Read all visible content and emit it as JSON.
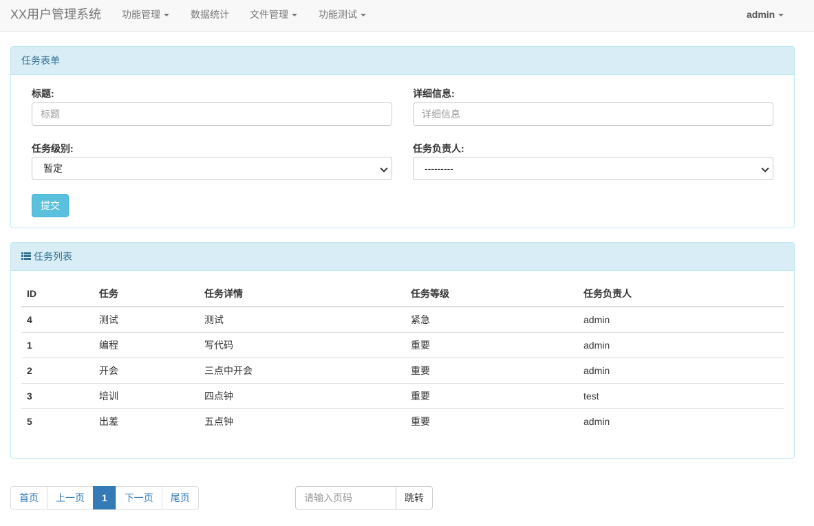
{
  "navbar": {
    "brand": "XX用户管理系统",
    "items": [
      {
        "label": "功能管理",
        "has_dropdown": true
      },
      {
        "label": "数据统计",
        "has_dropdown": false
      },
      {
        "label": "文件管理",
        "has_dropdown": true
      },
      {
        "label": "功能测试",
        "has_dropdown": true
      }
    ],
    "user": "admin"
  },
  "task_form": {
    "heading": "任务表单",
    "title_label": "标题:",
    "title_placeholder": "标题",
    "detail_label": "详细信息:",
    "detail_placeholder": "详细信息",
    "level_label": "任务级别:",
    "level_selected": "暂定",
    "owner_label": "任务负责人:",
    "owner_selected": "---------",
    "submit_label": "提交"
  },
  "task_list": {
    "heading": "任务列表",
    "icon": "list-icon",
    "columns": [
      "ID",
      "任务",
      "任务详情",
      "任务等级",
      "任务负责人"
    ],
    "rows": [
      [
        "4",
        "测试",
        "测试",
        "紧急",
        "admin"
      ],
      [
        "1",
        "编程",
        "写代码",
        "重要",
        "admin"
      ],
      [
        "2",
        "开会",
        "三点中开会",
        "重要",
        "admin"
      ],
      [
        "3",
        "培训",
        "四点钟",
        "重要",
        "test"
      ],
      [
        "5",
        "出差",
        "五点钟",
        "重要",
        "admin"
      ]
    ]
  },
  "pagination": {
    "first": "首页",
    "prev": "上一页",
    "current": "1",
    "next": "下一页",
    "last": "尾页",
    "jump_placeholder": "请输入页码",
    "jump_button": "跳转"
  },
  "colors": {
    "panel_heading_bg": "#d9edf7",
    "panel_border": "#bce8f1",
    "submit_button": "#5bc0de",
    "active_page": "#337ab7"
  }
}
